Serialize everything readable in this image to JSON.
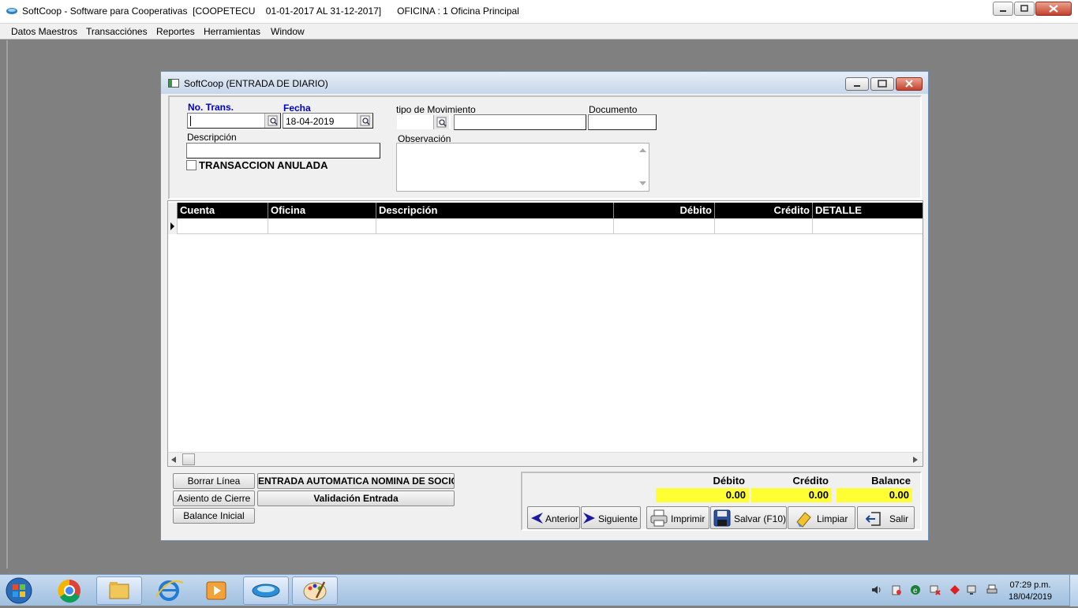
{
  "window": {
    "title": "SoftCoop - Software para Cooperativas  [COOPETECU    01-01-2017 AL 31-12-2017]      OFICINA : 1 Oficina Principal"
  },
  "menu": [
    "Datos Maestros",
    "Transacciónes",
    "Reportes",
    "Herramientas",
    "Window"
  ],
  "dialog": {
    "title": "SoftCoop (ENTRADA DE DIARIO)",
    "no_trans_label": "No. Trans.",
    "no_trans_value": "",
    "fecha_label": "Fecha",
    "fecha_value": "18-04-2019",
    "tipo_mov_label": "tipo de Movimiento",
    "tipo_mov_value": "",
    "tipo_mov_desc": "",
    "documento_label": "Documento",
    "documento_value": "",
    "descripcion_label": "Descripción",
    "descripcion_value": "",
    "observacion_label": "Observación",
    "observacion_value": "",
    "anulada_label": "TRANSACCION ANULADA",
    "anulada_checked": false
  },
  "grid": {
    "columns": [
      "Cuenta",
      "Oficina",
      "Descripción",
      "Débito",
      "Crédito",
      "DETALLE"
    ],
    "rows": []
  },
  "actions": {
    "borrar_linea": "Borrar Línea",
    "asiento_cierre": "Asiento de Cierre",
    "balance_inicial": "Balance Inicial",
    "entrada_automatica": "ENTRADA AUTOMATICA NOMINA DE SOCIOS",
    "validacion_entrada": "Validación Entrada"
  },
  "totals": {
    "debito_label": "Débito",
    "credito_label": "Crédito",
    "balance_label": "Balance",
    "debito": "0.00",
    "credito": "0.00",
    "balance": "0.00"
  },
  "nav": {
    "anterior": "Anterior",
    "siguiente": "Siguiente",
    "imprimir": "Imprimir",
    "salvar": "Salvar (F10)",
    "limpiar": "Limpiar",
    "salir": "Salir"
  },
  "taskbar": {
    "app_label": "SoftCoop",
    "time": "07:29 p.m.",
    "date": "18/04/2019"
  },
  "colors": {
    "accent": "#0000cc",
    "totals_bg": "#ffff33",
    "grid_header": "#000000"
  }
}
